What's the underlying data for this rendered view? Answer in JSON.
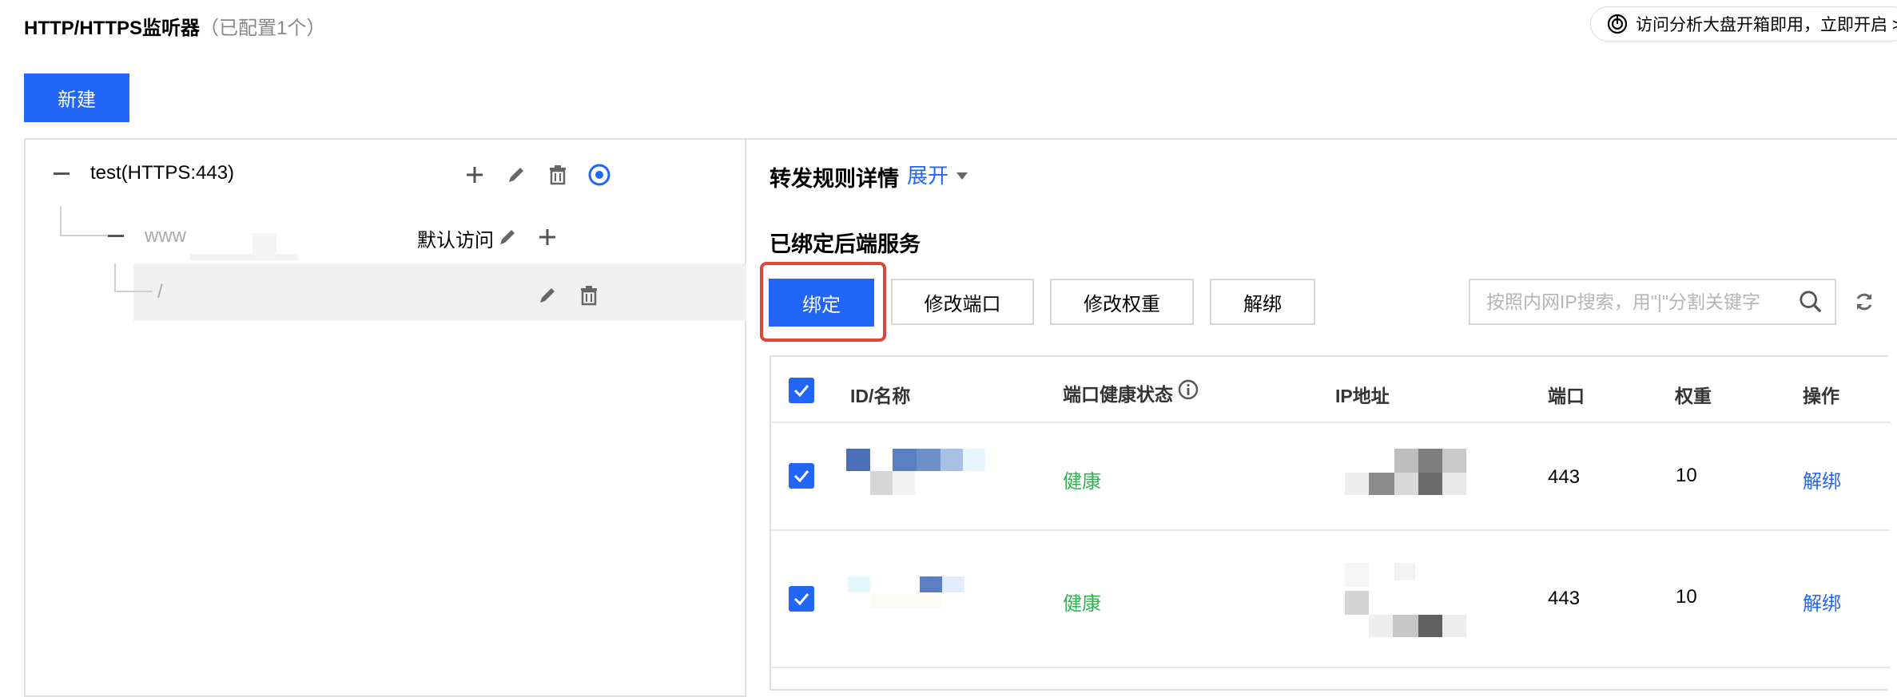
{
  "header": {
    "title": "HTTP/HTTPS监听器",
    "title_count": "（已配置1个）",
    "promo_text": "访问分析大盘开箱即用，立即开启 >",
    "new_button": "新建"
  },
  "tree": {
    "listener_label": "test(HTTPS:443)",
    "domain_label": "www",
    "domain_tag": "默认访问",
    "path_label": "/"
  },
  "detail": {
    "rule_title": "转发规则详情",
    "expand_label": "展开",
    "backend_title": "已绑定后端服务"
  },
  "toolbar": {
    "bind": "绑定",
    "modify_port": "修改端口",
    "modify_weight": "修改权重",
    "unbind": "解绑",
    "search_placeholder": "按照内网IP搜索，用\"|\"分割关键字"
  },
  "table": {
    "columns": [
      "ID/名称",
      "端口健康状态",
      "IP地址",
      "端口",
      "权重",
      "操作"
    ],
    "rows": [
      {
        "health": "健康",
        "port": "443",
        "weight": "10",
        "action": "解绑"
      },
      {
        "health": "健康",
        "port": "443",
        "weight": "10",
        "action": "解绑"
      }
    ]
  },
  "colors": {
    "primary": "#2166f6",
    "healthy": "#2fb34f",
    "highlight": "#d9483b"
  },
  "icons": [
    "gauge-icon",
    "plus-icon",
    "edit-icon",
    "delete-icon",
    "target-icon",
    "info-icon",
    "search-icon",
    "refresh-icon",
    "check-icon"
  ]
}
